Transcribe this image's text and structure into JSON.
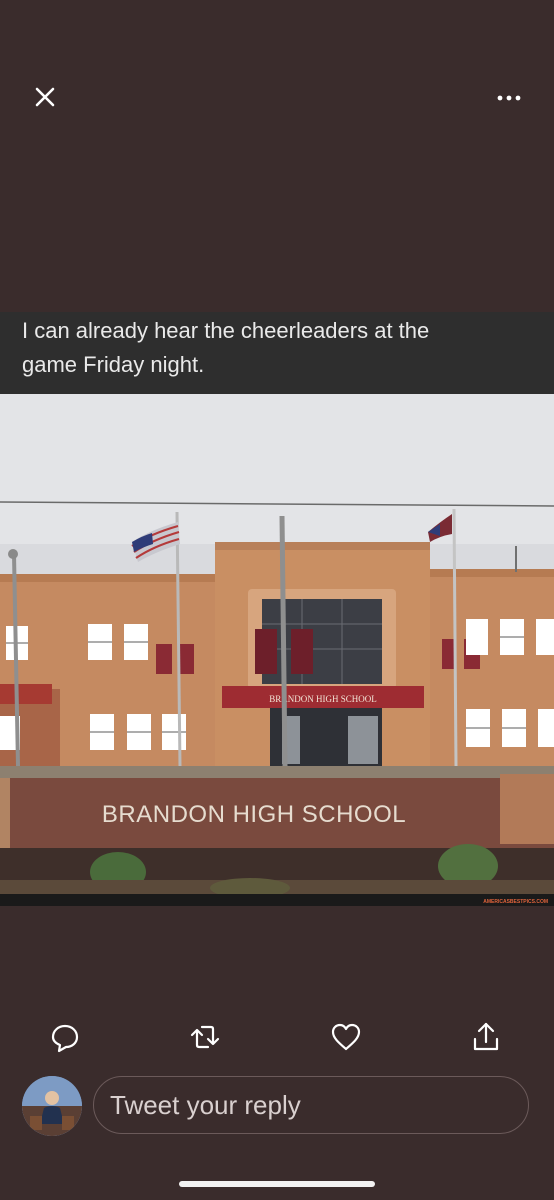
{
  "caption": {
    "line1": "I can already hear the cheerleaders at the",
    "line2": "game Friday night."
  },
  "sign_text": "BRANDON HIGH SCHOOL",
  "entrance_sign_text": "BRANDON HIGH SCHOOL",
  "watermark": "AMERICASBESTPICS.COM",
  "reply": {
    "placeholder": "Tweet your reply"
  },
  "icons": {
    "close": "close-icon",
    "more": "more-icon",
    "reply": "reply-icon",
    "retweet": "retweet-icon",
    "like": "like-icon",
    "share": "share-icon"
  },
  "colors": {
    "background": "#3a2c2c",
    "caption_band": "#2e2e2e",
    "brick": "#c58a61"
  }
}
